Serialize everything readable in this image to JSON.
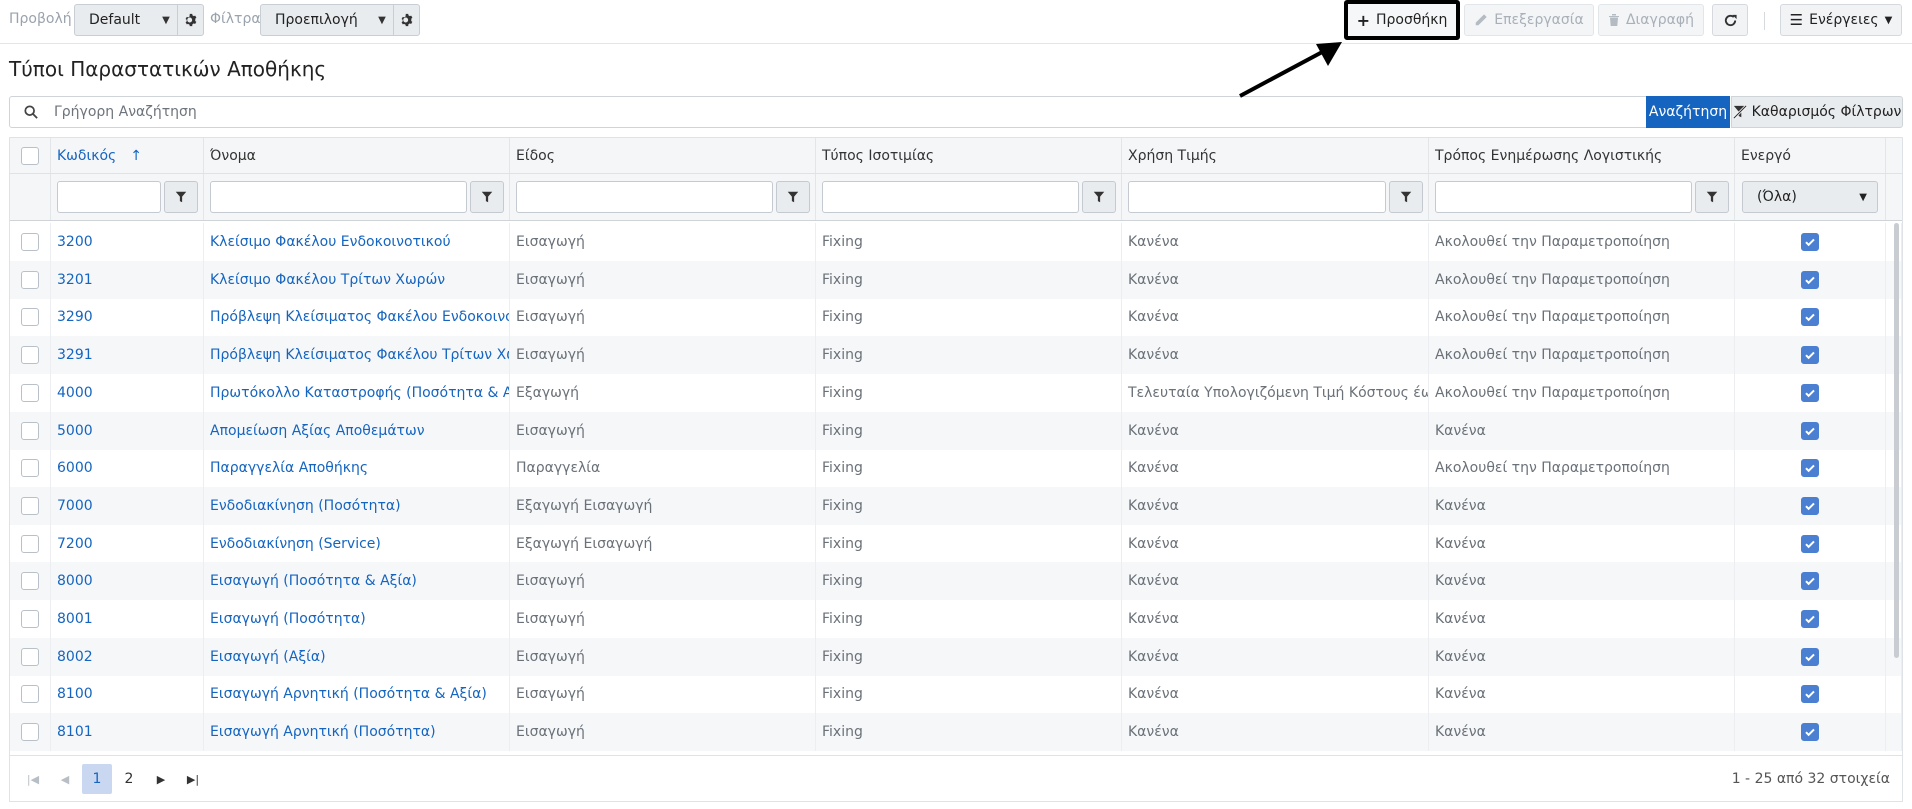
{
  "toolbar": {
    "view_label": "Προβολή",
    "view_value": "Default",
    "filter_label": "Φίλτρα",
    "filter_value": "Προεπιλογή",
    "add_label": "Προσθήκη",
    "edit_label": "Επεξεργασία",
    "delete_label": "Διαγραφή",
    "actions_label": "Ενέργειες"
  },
  "page": {
    "title": "Τύποι Παραστατικών Αποθήκης"
  },
  "search": {
    "placeholder": "Γρήγορη Αναζήτηση",
    "search_label": "Αναζήτηση",
    "clear_label": "Καθαρισμός Φίλτρων"
  },
  "grid": {
    "columns": [
      "Κωδικός",
      "Όνομα",
      "Είδος",
      "Τύπος Ισοτιμίας",
      "Χρήση Τιμής",
      "Τρόπος Ενημέρωσης Λογιστικής",
      "Ενεργό"
    ],
    "sorted_column": "Κωδικός",
    "sort_direction": "ascending",
    "active_filter": "(Όλα)",
    "rows": [
      {
        "code": "3200",
        "name": "Κλείσιμο Φακέλου Ενδοκοινοτικού",
        "kind": "Εισαγωγή",
        "rate": "Fixing",
        "price": "Κανένα",
        "acct": "Ακολουθεί την Παραμετροποίηση",
        "active": true
      },
      {
        "code": "3201",
        "name": "Κλείσιμο Φακέλου Τρίτων Χωρών",
        "kind": "Εισαγωγή",
        "rate": "Fixing",
        "price": "Κανένα",
        "acct": "Ακολουθεί την Παραμετροποίηση",
        "active": true
      },
      {
        "code": "3290",
        "name": "Πρόβλεψη Κλείσιματος Φακέλου Ενδοκοινοτι",
        "kind": "Εισαγωγή",
        "rate": "Fixing",
        "price": "Κανένα",
        "acct": "Ακολουθεί την Παραμετροποίηση",
        "active": true
      },
      {
        "code": "3291",
        "name": "Πρόβλεψη Κλείσιματος Φακέλου Τρίτων Χωρι",
        "kind": "Εισαγωγή",
        "rate": "Fixing",
        "price": "Κανένα",
        "acct": "Ακολουθεί την Παραμετροποίηση",
        "active": true
      },
      {
        "code": "4000",
        "name": "Πρωτόκολλο Καταστροφής (Ποσότητα & Αξία)",
        "kind": "Εξαγωγή",
        "rate": "Fixing",
        "price": "Τελευταία Υπολογιζόμενη Τιμή Κόστους έω...",
        "acct": "Ακολουθεί την Παραμετροποίηση",
        "active": true
      },
      {
        "code": "5000",
        "name": "Απομείωση Αξίας Αποθεμάτων",
        "kind": "Εισαγωγή",
        "rate": "Fixing",
        "price": "Κανένα",
        "acct": "Κανένα",
        "active": true
      },
      {
        "code": "6000",
        "name": "Παραγγελία Αποθήκης",
        "kind": "Παραγγελία",
        "rate": "Fixing",
        "price": "Κανένα",
        "acct": "Ακολουθεί την Παραμετροποίηση",
        "active": true
      },
      {
        "code": "7000",
        "name": "Ενδοδιακίνηση (Ποσότητα)",
        "kind": "Εξαγωγή Εισαγωγή",
        "rate": "Fixing",
        "price": "Κανένα",
        "acct": "Κανένα",
        "active": true
      },
      {
        "code": "7200",
        "name": "Ενδοδιακίνηση (Service)",
        "kind": "Εξαγωγή Εισαγωγή",
        "rate": "Fixing",
        "price": "Κανένα",
        "acct": "Κανένα",
        "active": true
      },
      {
        "code": "8000",
        "name": "Εισαγωγή (Ποσότητα & Αξία)",
        "kind": "Εισαγωγή",
        "rate": "Fixing",
        "price": "Κανένα",
        "acct": "Κανένα",
        "active": true
      },
      {
        "code": "8001",
        "name": "Εισαγωγή (Ποσότητα)",
        "kind": "Εισαγωγή",
        "rate": "Fixing",
        "price": "Κανένα",
        "acct": "Κανένα",
        "active": true
      },
      {
        "code": "8002",
        "name": "Εισαγωγή (Αξία)",
        "kind": "Εισαγωγή",
        "rate": "Fixing",
        "price": "Κανένα",
        "acct": "Κανένα",
        "active": true
      },
      {
        "code": "8100",
        "name": "Εισαγωγή Αρνητική (Ποσότητα & Αξία)",
        "kind": "Εισαγωγή",
        "rate": "Fixing",
        "price": "Κανένα",
        "acct": "Κανένα",
        "active": true
      },
      {
        "code": "8101",
        "name": "Εισαγωγή Αρνητική (Ποσότητα)",
        "kind": "Εισαγωγή",
        "rate": "Fixing",
        "price": "Κανένα",
        "acct": "Κανένα",
        "active": true
      }
    ]
  },
  "pager": {
    "pages": [
      "1",
      "2"
    ],
    "current_page": "1",
    "info": "1 - 25 από 32 στοιχεία"
  },
  "colors": {
    "accent": "#1565c0",
    "checkbox": "#4a7fd1",
    "annotation": "#000000"
  }
}
